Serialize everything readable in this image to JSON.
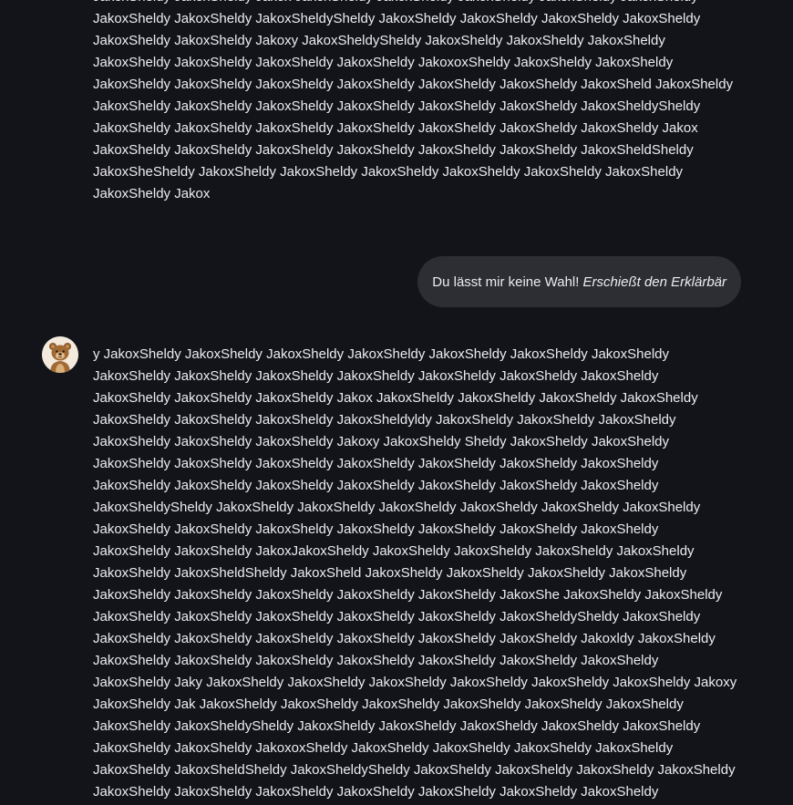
{
  "conversation": {
    "bot_message_1": {
      "lines": [
        "JakoxSheldy JakoxSheldy Jakox JakoxSheldy JakoxSheldy JakoxSheldy JakoxSheldy JakoxSheldy",
        "JakoxSheldy JakoxSheldy JakoxSheldySheldy JakoxSheldy JakoxSheldy JakoxSheldy JakoxSheldy",
        "JakoxSheldy JakoxSheldy Jakoxy JakoxSheldySheldy JakoxSheldy JakoxSheldy JakoxSheldy",
        "JakoxSheldy JakoxSheldy JakoxSheldy JakoxSheldy JakoxoxSheldy JakoxSheldy JakoxSheldy",
        "JakoxSheldy JakoxSheldy JakoxSheldy JakoxSheldy JakoxSheldy JakoxSheldy JakoxSheld JakoxSheldy",
        "JakoxSheldy JakoxSheldy JakoxSheldy JakoxSheldy JakoxSheldy JakoxSheldy JakoxSheldySheldy",
        "JakoxSheldy JakoxSheldy JakoxSheldy JakoxSheldy JakoxSheldy JakoxSheldy JakoxSheldy Jakox",
        "JakoxSheldy JakoxSheldy JakoxSheldy JakoxSheldy JakoxSheldy JakoxSheldy JakoxSheldSheldy",
        "JakoxSheSheldy JakoxSheldy JakoxSheldy JakoxSheldy JakoxSheldy JakoxSheldy JakoxSheldy",
        "JakoxSheldy Jakox"
      ]
    },
    "user_message": {
      "text": "Du lässt mir keine Wahl!",
      "action": "Erschießt den Erklärbär"
    },
    "bot_avatar": {
      "icon": "bear-avatar-icon"
    },
    "bot_message_2": {
      "lines": [
        "y JakoxSheldy JakoxSheldy JakoxSheldy JakoxSheldy JakoxSheldy JakoxSheldy JakoxSheldy",
        "JakoxSheldy JakoxSheldy JakoxSheldy JakoxSheldy JakoxSheldy JakoxSheldy JakoxSheldy",
        "JakoxSheldy JakoxSheldy JakoxSheldy Jakox JakoxSheldy JakoxSheldy JakoxSheldy JakoxSheldy",
        "JakoxSheldy JakoxSheldy JakoxSheldy JakoxSheldyldy JakoxSheldy JakoxSheldy JakoxSheldy",
        "JakoxSheldy JakoxSheldy JakoxSheldy Jakoxy JakoxSheldy Sheldy JakoxSheldy JakoxSheldy",
        "JakoxSheldy JakoxSheldy JakoxSheldy JakoxSheldy JakoxSheldy JakoxSheldy JakoxSheldy",
        "JakoxSheldy JakoxSheldy JakoxSheldy JakoxSheldy JakoxSheldy JakoxSheldy JakoxSheldy",
        "JakoxSheldySheldy JakoxSheldy JakoxSheldy JakoxSheldy JakoxSheldy JakoxSheldy JakoxSheldy",
        "JakoxSheldy JakoxSheldy JakoxSheldy JakoxSheldy JakoxSheldy JakoxSheldy JakoxSheldy",
        "JakoxSheldy JakoxSheldy JakoxJakoxSheldy JakoxSheldy JakoxSheldy JakoxSheldy JakoxSheldy",
        "JakoxSheldy JakoxSheldSheldy JakoxSheld JakoxSheldy JakoxSheldy JakoxSheldy JakoxSheldy",
        "JakoxSheldy JakoxSheldy JakoxSheldy JakoxSheldy JakoxSheldy JakoxShe JakoxSheldy JakoxSheldy",
        "JakoxSheldy JakoxSheldy JakoxSheldy JakoxSheldy JakoxSheldy JakoxSheldySheldy JakoxSheldy",
        "JakoxSheldy JakoxSheldy JakoxSheldy JakoxSheldy JakoxSheldy JakoxSheldy Jakoxldy JakoxSheldy",
        "JakoxSheldy JakoxSheldy JakoxSheldy JakoxSheldy JakoxSheldy JakoxSheldy JakoxSheldy",
        "JakoxSheldy Jaky JakoxSheldy JakoxSheldy JakoxSheldy JakoxSheldy JakoxSheldy JakoxSheldy Jakoxy",
        "JakoxSheldy Jak JakoxSheldy JakoxSheldy JakoxSheldy JakoxSheldy JakoxSheldy JakoxSheldy",
        "JakoxSheldy JakoxSheldySheldy JakoxSheldy JakoxSheldy JakoxSheldy JakoxSheldy JakoxSheldy",
        "JakoxSheldy JakoxSheldy JakoxoxSheldy JakoxSheldy JakoxSheldy JakoxSheldy JakoxSheldy",
        "JakoxSheldy JakoxSheldSheldy JakoxSheldySheldy JakoxSheldy JakoxSheldy JakoxSheldy JakoxSheldy",
        "JakoxSheldy JakoxSheldy JakoxSheldy JakoxSheldy JakoxSheldy JakoxSheldy JakoxSheldy"
      ]
    }
  },
  "colors": {
    "background": "#131419",
    "text": "#ececf1",
    "user_bubble": "#2c2e33"
  }
}
